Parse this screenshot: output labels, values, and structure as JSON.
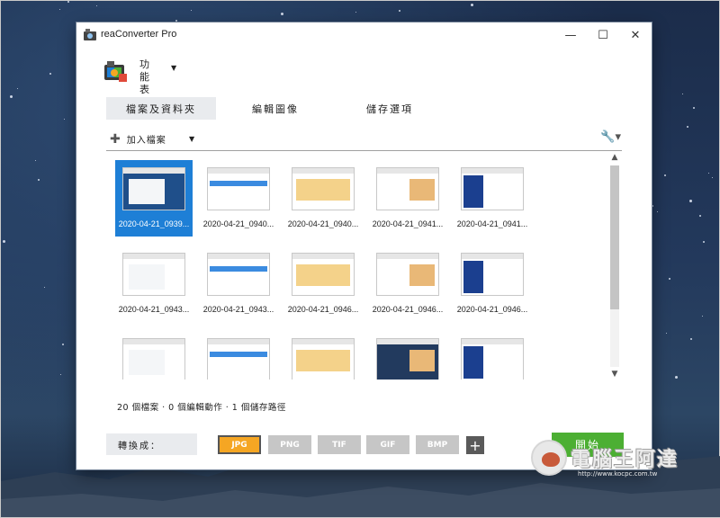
{
  "window": {
    "title": "reaConverter Pro",
    "minimize": "—",
    "maximize": "☐",
    "close": "✕"
  },
  "menu": {
    "label": "功能表",
    "icon": "camera-app-icon"
  },
  "tabs": [
    {
      "label": "檔案及資料夾",
      "active": true
    },
    {
      "label": "編輯圖像",
      "active": false
    },
    {
      "label": "儲存選項",
      "active": false
    }
  ],
  "toolbar": {
    "add_files": "加入檔案",
    "settings_icon": "wrench-icon"
  },
  "thumbnails": [
    {
      "label": "2020-04-21_0939...",
      "selected": true
    },
    {
      "label": "2020-04-21_0940...",
      "selected": false
    },
    {
      "label": "2020-04-21_0940...",
      "selected": false
    },
    {
      "label": "2020-04-21_0941...",
      "selected": false
    },
    {
      "label": "2020-04-21_0941...",
      "selected": false
    },
    {
      "label": "2020-04-21_0943...",
      "selected": false
    },
    {
      "label": "2020-04-21_0943...",
      "selected": false
    },
    {
      "label": "2020-04-21_0946...",
      "selected": false
    },
    {
      "label": "2020-04-21_0946...",
      "selected": false
    },
    {
      "label": "2020-04-21_0946...",
      "selected": false
    },
    {
      "label": "",
      "selected": false
    },
    {
      "label": "",
      "selected": false
    },
    {
      "label": "",
      "selected": false
    },
    {
      "label": "",
      "selected": false
    },
    {
      "label": "",
      "selected": false
    }
  ],
  "status": "20 個檔案 · 0 個編輯動作 · 1 個儲存路徑",
  "convert": {
    "label": "轉換成：",
    "formats": [
      {
        "label": "JPG",
        "active": true
      },
      {
        "label": "PNG",
        "active": false
      },
      {
        "label": "TIF",
        "active": false
      },
      {
        "label": "GIF",
        "active": false
      },
      {
        "label": "BMP",
        "active": false
      }
    ],
    "add_format": "+",
    "start": "開始"
  },
  "watermark": {
    "text": "電腦王阿達",
    "url": "http://www.kocpc.com.tw"
  },
  "colors": {
    "accent_blue": "#1e7fd6",
    "start_green": "#4caf33",
    "active_format": "#f5a623"
  }
}
